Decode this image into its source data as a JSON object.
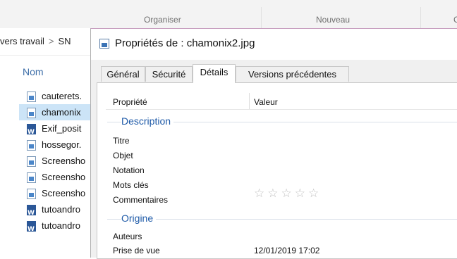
{
  "ribbon": {
    "groups": [
      "Organiser",
      "Nouveau",
      "C"
    ]
  },
  "breadcrumb": {
    "part1": "vers travail",
    "chevron": ">",
    "part2": "SN"
  },
  "file_list": {
    "column_header": "Nom",
    "files": [
      {
        "name": "cauterets.",
        "type": "image",
        "selected": false
      },
      {
        "name": "chamonix",
        "type": "image",
        "selected": true
      },
      {
        "name": "Exif_posit",
        "type": "word",
        "selected": false
      },
      {
        "name": "hossegor.",
        "type": "image",
        "selected": false
      },
      {
        "name": "Screensho",
        "type": "image",
        "selected": false
      },
      {
        "name": "Screensho",
        "type": "image",
        "selected": false
      },
      {
        "name": "Screensho",
        "type": "image",
        "selected": false
      },
      {
        "name": "tutoandro",
        "type": "word",
        "selected": false
      },
      {
        "name": "tutoandro",
        "type": "word",
        "selected": false
      }
    ]
  },
  "dialog": {
    "title": "Propriétés de : chamonix2.jpg",
    "tabs": [
      "Général",
      "Sécurité",
      "Détails",
      "Versions précédentes"
    ],
    "active_tab": "Détails",
    "details": {
      "col_property": "Propriété",
      "col_value": "Valeur",
      "section_description": "Description",
      "titre": "Titre",
      "objet": "Objet",
      "notation": "Notation",
      "rating_stars": "☆☆☆☆☆",
      "mots_cles": "Mots clés",
      "commentaires": "Commentaires",
      "section_origine": "Origine",
      "auteurs": "Auteurs",
      "prise_de_vue": "Prise de vue",
      "prise_de_vue_value": "12/01/2019 17:02"
    }
  },
  "colors": {
    "accent": "#1e5aa8",
    "selection": "#cce4f7",
    "word_blue": "#2b5797"
  }
}
